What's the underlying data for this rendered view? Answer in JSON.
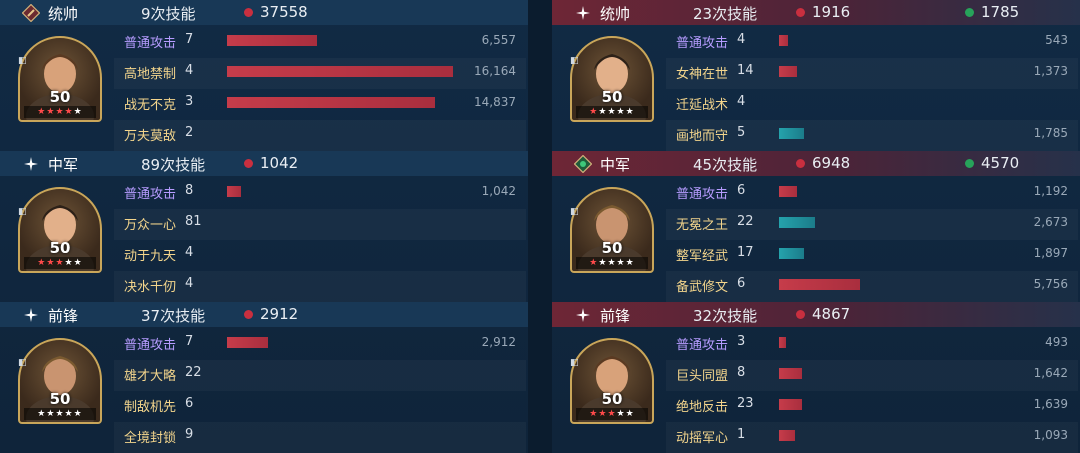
{
  "left": {
    "sections": [
      {
        "role": "统帅",
        "skill_count": "9次技能",
        "damage": "37558",
        "heal": null,
        "level": "50",
        "stars": 5,
        "red_stars": 4,
        "skills": [
          {
            "name": "普通攻击",
            "times": "7",
            "damage": "6,557",
            "bar": 0.2,
            "type": "normal",
            "color": "red"
          },
          {
            "name": "高地禁制",
            "times": "4",
            "damage": "16,164",
            "bar": 0.5,
            "type": "skill",
            "color": "red"
          },
          {
            "name": "战无不克",
            "times": "3",
            "damage": "14,837",
            "bar": 0.46,
            "type": "skill",
            "color": "red"
          },
          {
            "name": "万夫莫敌",
            "times": "2",
            "damage": "",
            "bar": 0,
            "type": "skill",
            "color": "red"
          }
        ]
      },
      {
        "role": "中军",
        "skill_count": "89次技能",
        "damage": "1042",
        "heal": null,
        "level": "50",
        "stars": 5,
        "red_stars": 3,
        "skills": [
          {
            "name": "普通攻击",
            "times": "8",
            "damage": "1,042",
            "bar": 0.03,
            "type": "normal",
            "color": "red"
          },
          {
            "name": "万众一心",
            "times": "81",
            "damage": "",
            "bar": 0,
            "type": "skill",
            "color": "red"
          },
          {
            "name": "动于九天",
            "times": "4",
            "damage": "",
            "bar": 0,
            "type": "skill",
            "color": "red"
          },
          {
            "name": "决水千仞",
            "times": "4",
            "damage": "",
            "bar": 0,
            "type": "skill",
            "color": "red"
          }
        ]
      },
      {
        "role": "前锋",
        "skill_count": "37次技能",
        "damage": "2912",
        "heal": null,
        "level": "50",
        "stars": 5,
        "red_stars": 0,
        "skills": [
          {
            "name": "普通攻击",
            "times": "7",
            "damage": "2,912",
            "bar": 0.09,
            "type": "normal",
            "color": "red"
          },
          {
            "name": "雄才大略",
            "times": "22",
            "damage": "",
            "bar": 0,
            "type": "skill",
            "color": "red"
          },
          {
            "name": "制敌机先",
            "times": "6",
            "damage": "",
            "bar": 0,
            "type": "skill",
            "color": "red"
          },
          {
            "name": "全境封锁",
            "times": "9",
            "damage": "",
            "bar": 0,
            "type": "skill",
            "color": "red"
          }
        ]
      }
    ]
  },
  "right": {
    "sections": [
      {
        "role": "统帅",
        "skill_count": "23次技能",
        "damage": "1916",
        "heal": "1785",
        "level": "50",
        "stars": 5,
        "red_stars": 1,
        "skills": [
          {
            "name": "普通攻击",
            "times": "4",
            "damage": "543",
            "bar": 0.02,
            "type": "normal",
            "color": "red"
          },
          {
            "name": "女神在世",
            "times": "14",
            "damage": "1,373",
            "bar": 0.04,
            "type": "skill",
            "color": "red"
          },
          {
            "name": "迁延战术",
            "times": "4",
            "damage": "",
            "bar": 0,
            "type": "skill",
            "color": "red"
          },
          {
            "name": "画地而守",
            "times": "5",
            "damage": "1,785",
            "bar": 0.055,
            "type": "skill",
            "color": "teal"
          }
        ]
      },
      {
        "role": "中军",
        "skill_count": "45次技能",
        "damage": "6948",
        "heal": "4570",
        "level": "50",
        "stars": 5,
        "red_stars": 1,
        "skills": [
          {
            "name": "普通攻击",
            "times": "6",
            "damage": "1,192",
            "bar": 0.04,
            "type": "normal",
            "color": "red"
          },
          {
            "name": "无冕之王",
            "times": "22",
            "damage": "2,673",
            "bar": 0.08,
            "type": "skill",
            "color": "teal"
          },
          {
            "name": "整军经武",
            "times": "17",
            "damage": "1,897",
            "bar": 0.055,
            "type": "skill",
            "color": "teal"
          },
          {
            "name": "备武修文",
            "times": "6",
            "damage": "5,756",
            "bar": 0.18,
            "type": "skill",
            "color": "red"
          }
        ]
      },
      {
        "role": "前锋",
        "skill_count": "32次技能",
        "damage": "4867",
        "heal": null,
        "level": "50",
        "stars": 5,
        "red_stars": 3,
        "skills": [
          {
            "name": "普通攻击",
            "times": "3",
            "damage": "493",
            "bar": 0.015,
            "type": "normal",
            "color": "red"
          },
          {
            "name": "巨头同盟",
            "times": "8",
            "damage": "1,642",
            "bar": 0.05,
            "type": "skill",
            "color": "red"
          },
          {
            "name": "绝地反击",
            "times": "23",
            "damage": "1,639",
            "bar": 0.05,
            "type": "skill",
            "color": "red"
          },
          {
            "name": "动摇军心",
            "times": "1",
            "damage": "1,093",
            "bar": 0.035,
            "type": "skill",
            "color": "red"
          }
        ]
      }
    ]
  },
  "colors": {
    "damage_dot": "#c92f3f",
    "heal_dot": "#27a35a",
    "bar_red": "#c63c4a",
    "bar_teal": "#25a3ac",
    "normal_attack_text": "#b69cff",
    "skill_text": "#f3d58c"
  },
  "icons": {
    "commander_role": "diamond-badge-icon",
    "role": "sparkle-icon"
  }
}
